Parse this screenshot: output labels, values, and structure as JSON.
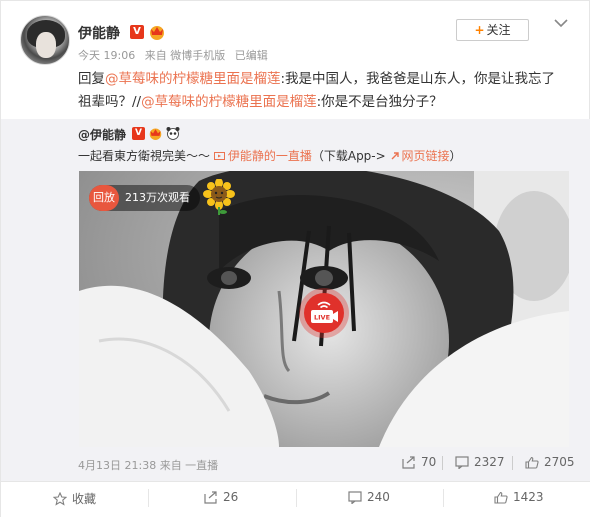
{
  "post": {
    "username": "伊能静",
    "v_badge": "V",
    "meta": {
      "time": "今天 19:06",
      "source": "来自 微博手机版",
      "edited": "已编辑"
    },
    "follow_label": "关注",
    "text": {
      "reply_prefix": "回复",
      "mention1": "@草莓味的柠檬糖里面是榴莲",
      "part1": ":我是中国人，我爸爸是山东人，你是让我忘了祖辈吗？//",
      "mention2": "@草莓味的柠檬糖里面是榴莲",
      "part2": ":你是不是台独分子？"
    }
  },
  "repost": {
    "username": "@伊能静",
    "v_badge": "V",
    "text_prefix": "一起看東方衛視完美～～",
    "live_link": "伊能静的一直播",
    "app_hint": "（下载App->",
    "web_link": "网页链接",
    "web_suffix": "）",
    "video": {
      "replay_tag": "回放",
      "views": "213万次观看",
      "live_label": "LIVE"
    },
    "footer": {
      "date": "4月13日 21:38 来自 一直播",
      "reposts": "70",
      "comments": "2327",
      "likes": "2705"
    }
  },
  "actions": {
    "favorite": "收藏",
    "repost": "26",
    "comment": "240",
    "like": "1423"
  },
  "colors": {
    "accent": "#eb7350",
    "verified": "#e7371b",
    "follow_plus": "#ff8200",
    "live": "#e0312b"
  }
}
